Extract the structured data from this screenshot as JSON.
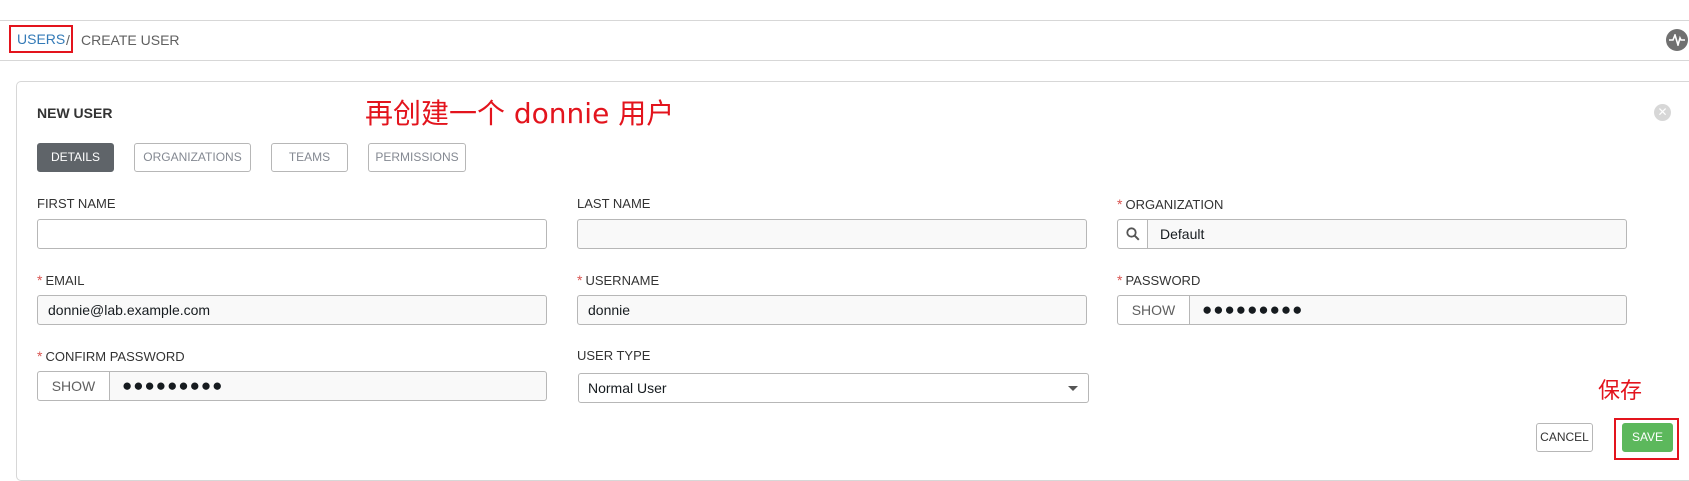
{
  "breadcrumb": {
    "users": "USERS",
    "separator": "/",
    "current": "CREATE USER"
  },
  "topbar": {
    "activity_icon": "activity-stream-icon"
  },
  "panel": {
    "title": "NEW USER",
    "close_icon": "close-icon"
  },
  "annotations": {
    "main": "再创建一个 donnie 用户",
    "save_hint": "保存"
  },
  "tabs": [
    {
      "label": "DETAILS",
      "active": true
    },
    {
      "label": "ORGANIZATIONS",
      "active": false
    },
    {
      "label": "TEAMS",
      "active": false
    },
    {
      "label": "PERMISSIONS",
      "active": false
    }
  ],
  "form": {
    "required_mark": "*",
    "first_name": {
      "label": "FIRST NAME",
      "value": ""
    },
    "last_name": {
      "label": "LAST NAME",
      "value": ""
    },
    "organization": {
      "label": "ORGANIZATION",
      "value": "Default",
      "icon": "search-icon"
    },
    "email": {
      "label": "EMAIL",
      "value": "donnie@lab.example.com"
    },
    "username": {
      "label": "USERNAME",
      "value": "donnie"
    },
    "password": {
      "label": "PASSWORD",
      "show_label": "SHOW",
      "masked": "●●●●●●●●●"
    },
    "confirm_password": {
      "label": "CONFIRM PASSWORD",
      "show_label": "SHOW",
      "masked": "●●●●●●●●●"
    },
    "user_type": {
      "label": "USER TYPE",
      "value": "Normal User"
    }
  },
  "actions": {
    "cancel": "CANCEL",
    "save": "SAVE"
  },
  "colors": {
    "accent_red": "#e3141d",
    "link_blue": "#337ab7",
    "save_green": "#5cb85c",
    "tab_active": "#5f6469"
  }
}
